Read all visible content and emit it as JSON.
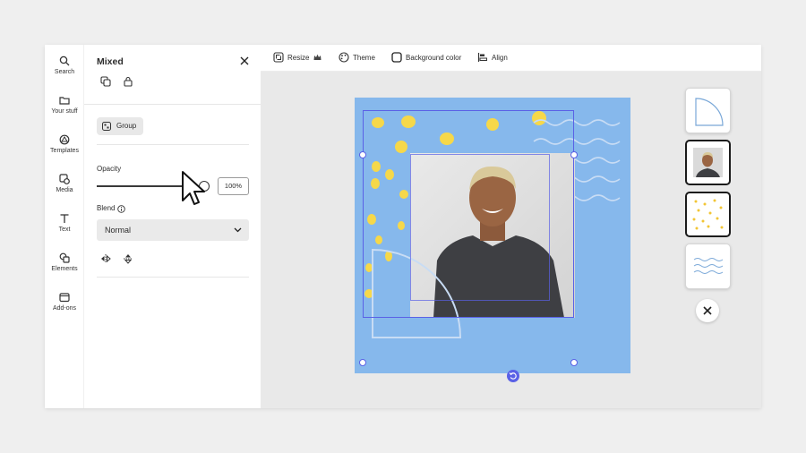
{
  "rail": {
    "items": [
      {
        "label": "Search",
        "icon": "search-icon"
      },
      {
        "label": "Your stuff",
        "icon": "folder-icon"
      },
      {
        "label": "Templates",
        "icon": "templates-icon"
      },
      {
        "label": "Media",
        "icon": "media-icon"
      },
      {
        "label": "Text",
        "icon": "text-icon"
      },
      {
        "label": "Elements",
        "icon": "shapes-icon"
      },
      {
        "label": "Add-ons",
        "icon": "addons-icon"
      }
    ]
  },
  "panel": {
    "title": "Mixed",
    "group_label": "Group",
    "opacity_label": "Opacity",
    "opacity_value": "100%",
    "opacity_fraction": 1.0,
    "blend_label": "Blend",
    "blend_value": "Normal"
  },
  "toolbar": {
    "resize_label": "Resize",
    "theme_label": "Theme",
    "background_label": "Background color",
    "align_label": "Align"
  },
  "colors": {
    "accent": "#5a61e6",
    "art_background": "#86b8ec",
    "dots": "#f6d84a",
    "wave": "#c8dcf4"
  },
  "thumbnails": [
    {
      "name": "quarter-circle-layer"
    },
    {
      "name": "photo-layer",
      "selected": true
    },
    {
      "name": "dots-layer",
      "selected": true
    },
    {
      "name": "waves-layer"
    }
  ]
}
